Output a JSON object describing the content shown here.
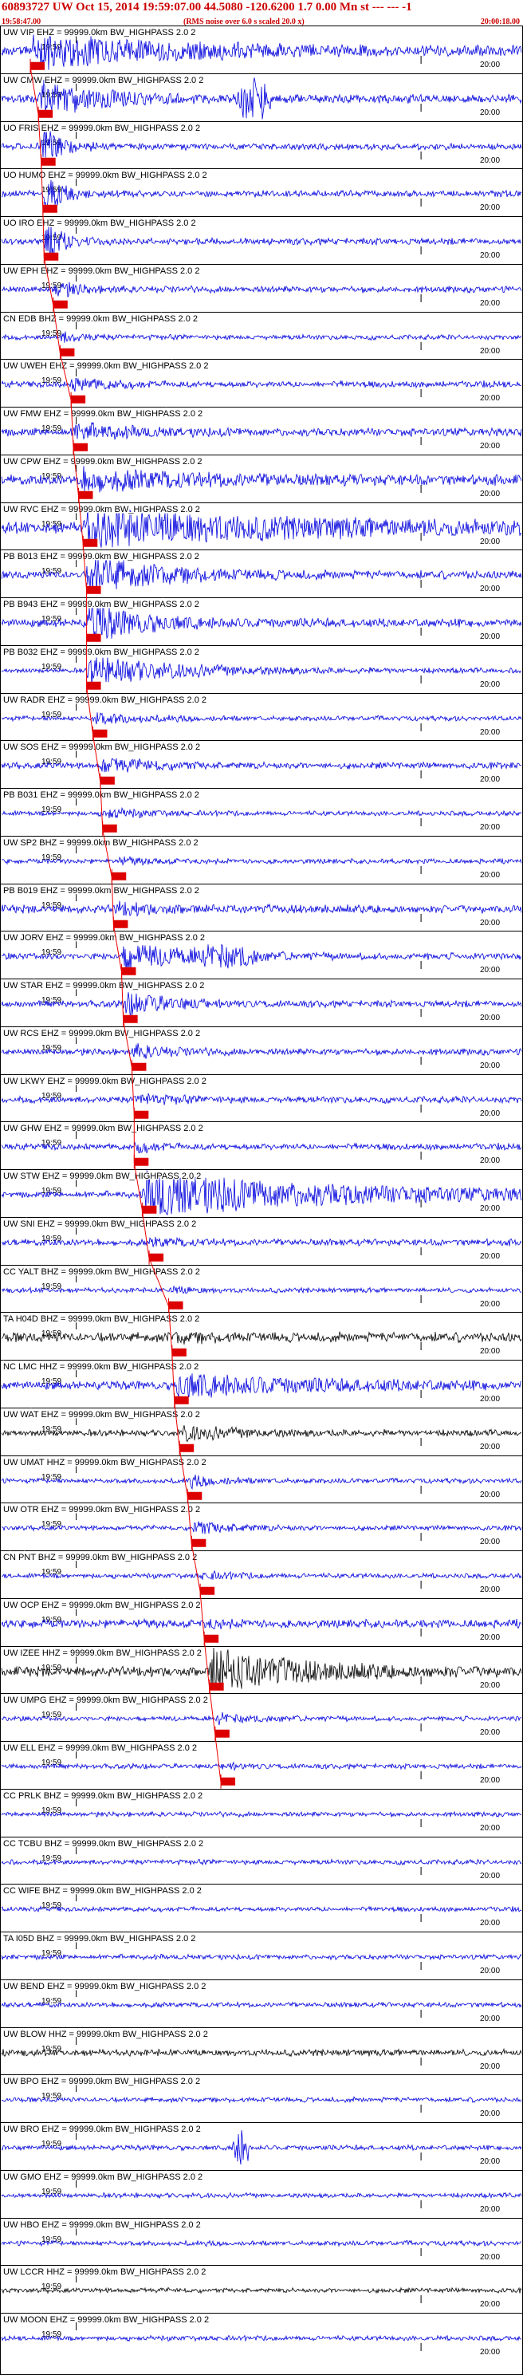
{
  "header": {
    "title": "60893727 UW Oct 15, 2014 19:59:07.00   44.5080 -120.6200  1.7 0.00 Mn st --- --- -1",
    "start_time": "19:58:47.00",
    "note": "(RMS noise over 6.0 s scaled 20.0 x)",
    "end_time": "20:00:18.00"
  },
  "colors": {
    "trace_primary": "#0000dd",
    "trace_secondary": "#000000",
    "pick": "#dd0000",
    "moveout_line": "#ee0000",
    "frame": "#000000"
  },
  "chart_data": {
    "type": "line",
    "title": "",
    "xlabel": "",
    "ylabel": "",
    "time_window": [
      "19:58:47.00",
      "20:00:18.00"
    ],
    "minute_tick_labels": [
      "19:59",
      "20:00"
    ],
    "channel_suffix": " = 99999.0km BW_HIGHPASS  2.0  2",
    "series": [
      {
        "name": "UW.VIP..EHZ",
        "color": "blue"
      },
      {
        "name": "UW.CMW.EHZ",
        "color": "blue"
      },
      {
        "name": "UO.FRIS.EHZ",
        "color": "blue"
      },
      {
        "name": "UO.HUMO.EHZ",
        "color": "blue"
      },
      {
        "name": "UO.IRO.EHZ",
        "color": "blue"
      },
      {
        "name": "UW.EPH.EHZ",
        "color": "blue"
      },
      {
        "name": "CN.EDB.BHZ",
        "color": "blue"
      },
      {
        "name": "UW.UWEH.EHZ",
        "color": "blue"
      },
      {
        "name": "UW.FMW.EHZ",
        "color": "blue"
      },
      {
        "name": "UW.CPW.EHZ",
        "color": "blue"
      },
      {
        "name": "UW.RVC.EHZ",
        "color": "blue"
      },
      {
        "name": "PB.B013.EHZ",
        "color": "blue"
      },
      {
        "name": "PB.B943.EHZ",
        "color": "blue"
      },
      {
        "name": "PB.B032.EHZ",
        "color": "blue"
      },
      {
        "name": "UW.RADR.EHZ",
        "color": "blue"
      },
      {
        "name": "UW.SOS.EHZ",
        "color": "blue"
      },
      {
        "name": "PB.B031.EHZ",
        "color": "blue"
      },
      {
        "name": "UW.SP2.BHZ",
        "color": "blue"
      },
      {
        "name": "PB.B019.EHZ",
        "color": "blue"
      },
      {
        "name": "UW.JORV.EHZ",
        "color": "blue"
      },
      {
        "name": "UW.STAR.EHZ",
        "color": "blue"
      },
      {
        "name": "UW.RCS.EHZ",
        "color": "blue"
      },
      {
        "name": "UW.LKWY.EHZ",
        "color": "blue"
      },
      {
        "name": "UW.GHW.EHZ",
        "color": "blue"
      },
      {
        "name": "UW.STW.EHZ",
        "color": "blue"
      },
      {
        "name": "UW.SNI.EHZ",
        "color": "blue"
      },
      {
        "name": "CC.YALT.BHZ",
        "color": "blue"
      },
      {
        "name": "TA.H04D.BHZ",
        "color": "black"
      },
      {
        "name": "NC.LMC.HHZ",
        "color": "blue"
      },
      {
        "name": "UW.WAT.EHZ",
        "color": "black"
      },
      {
        "name": "UW.UMAT.HHZ",
        "color": "blue"
      },
      {
        "name": "UW.OTR.EHZ",
        "color": "blue"
      },
      {
        "name": "CN.PNT.BHZ",
        "color": "blue"
      },
      {
        "name": "UW.OCP.EHZ",
        "color": "blue"
      },
      {
        "name": "UW.IZEE.HHZ",
        "color": "black"
      },
      {
        "name": "UW.UMPG.EHZ",
        "color": "blue"
      },
      {
        "name": "UW.ELL.EHZ",
        "color": "blue"
      },
      {
        "name": "CC.PRLK.BHZ",
        "color": "blue"
      },
      {
        "name": "CC.TCBU.BHZ",
        "color": "blue"
      },
      {
        "name": "CC.WIFE.BHZ",
        "color": "blue"
      },
      {
        "name": "TA.I05D.BHZ",
        "color": "blue"
      },
      {
        "name": "UW.BEND.EHZ",
        "color": "blue"
      },
      {
        "name": "UW.BLOW.HHZ",
        "color": "black"
      },
      {
        "name": "UW.BPO.EHZ",
        "color": "blue"
      },
      {
        "name": "UW.BRO.EHZ",
        "color": "blue"
      },
      {
        "name": "UW.GMO.EHZ",
        "color": "blue"
      },
      {
        "name": "UW.HBO.EHZ",
        "color": "blue"
      },
      {
        "name": "UW.LCCR.HHZ",
        "color": "black"
      },
      {
        "name": "UW.MOON.EHZ",
        "color": "blue"
      }
    ],
    "pick_times_s": [
      5.0,
      6.4,
      6.9,
      7.2,
      7.4,
      9.0,
      10.2,
      12.1,
      12.5,
      13.4,
      14.2,
      14.8,
      14.8,
      14.8,
      15.9,
      17.2,
      17.6,
      19.2,
      19.5,
      20.9,
      21.2,
      22.7,
      23.1,
      23.1,
      24.5,
      25.7,
      29.1,
      29.7,
      30.1,
      31.0,
      32.4,
      33.1,
      34.6,
      35.3,
      36.2,
      37.2,
      38.2
    ]
  }
}
